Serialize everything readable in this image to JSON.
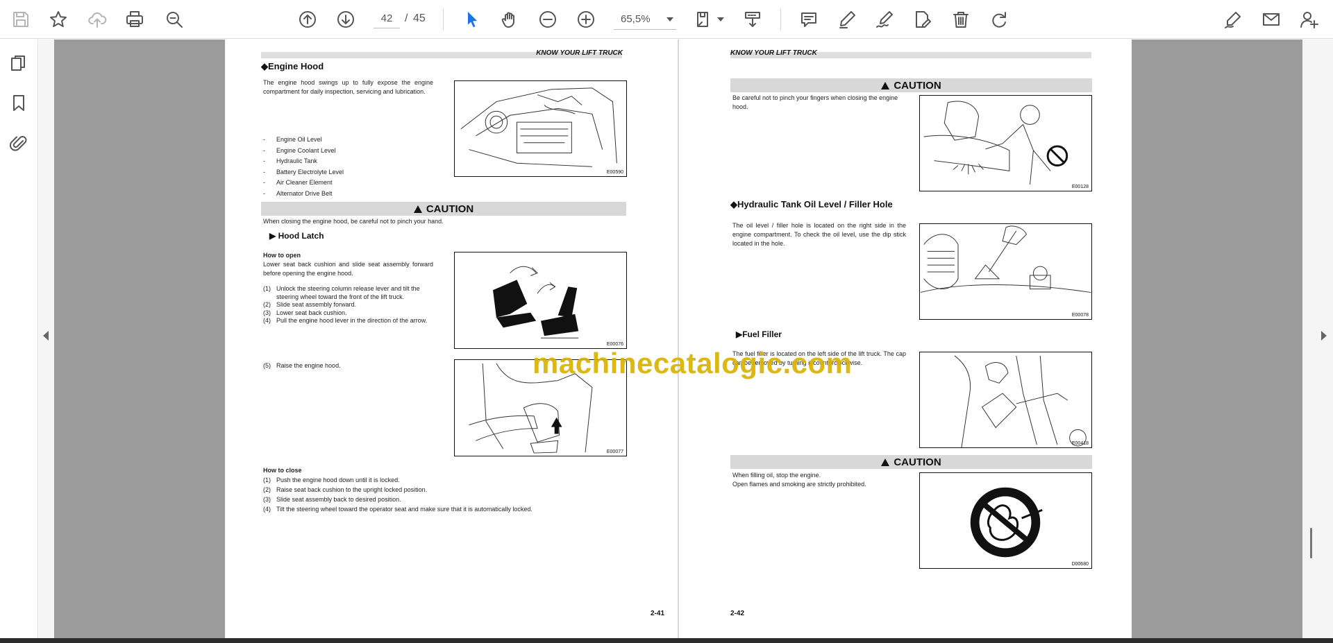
{
  "toolbar": {
    "page_current": "42",
    "page_separator": "/",
    "page_total": "45",
    "zoom": "65,5%"
  },
  "left_page": {
    "header": "KNOW YOUR LIFT TRUCK",
    "engine_hood_title": "◆Engine Hood",
    "engine_hood_intro": "The engine hood swings up to fully expose the engine compartment for daily inspection, servicing and lubrication.",
    "checklist": [
      "Engine Oil Level",
      "Engine Coolant Level",
      "Hydraulic Tank",
      "Battery Electrolyte Level",
      "Air Cleaner Element",
      "Alternator Drive Belt"
    ],
    "checklist_bullet": "-",
    "fig1_code": "E00590",
    "caution_label": "CAUTION",
    "caution_text": "When closing the engine hood, be careful not to pinch your hand.",
    "hood_latch_title": "▶ Hood Latch",
    "how_to_open_title": "How to open",
    "how_to_open_intro": "Lower seat back cushion and slide seat assembly forward before opening the engine hood.",
    "open_steps": [
      {
        "n": "(1)",
        "t": "Unlock the steering column release lever and tilt the"
      },
      {
        "n": "",
        "t": "steering wheel toward the front of the lift truck."
      },
      {
        "n": "(2)",
        "t": "Slide seat assembly forward."
      },
      {
        "n": "(3)",
        "t": "Lower seat back cushion."
      },
      {
        "n": "(4)",
        "t": "Pull the engine hood lever in the direction of the arrow."
      }
    ],
    "fig2_code": "E00076",
    "raise_step": {
      "n": "(5)",
      "t": "Raise the engine hood."
    },
    "fig3_code": "E00077",
    "how_to_close_title": "How to close",
    "close_steps": [
      {
        "n": "(1)",
        "t": "Push the engine hood down until it is locked."
      },
      {
        "n": "(2)",
        "t": "Raise seat back cushion to the upright locked position."
      },
      {
        "n": "(3)",
        "t": "Slide seat assembly back to desired position."
      },
      {
        "n": "(4)",
        "t": "Tilt the steering wheel toward the operator seat and make sure that it is automatically locked."
      }
    ],
    "page_number": "2-41"
  },
  "right_page": {
    "header": "KNOW YOUR LIFT TRUCK",
    "caution1_label": "CAUTION",
    "caution1_text": "Be careful not to pinch your fingers when closing the engine hood.",
    "fig1_code": "E00128",
    "hydraulic_title": "◆Hydraulic Tank Oil Level / Filler Hole",
    "hydraulic_text": "The oil level / filler hole is located on the right side in the engine compartment. To check the oil level, use the dip stick located in the hole.",
    "fig2_code": "E00078",
    "fuel_title": "▶Fuel Filler",
    "fuel_text": "The fuel filler is located on the left side of the lift truck. The cap can be removed by turning it counterclockwise.",
    "fig3_code": "E00418",
    "caution2_label": "CAUTION",
    "caution2_line1": "When filling oil, stop the engine.",
    "caution2_line2": "Open flames and smoking are strictly prohibited.",
    "fig4_code": "D00680",
    "page_number": "2-42"
  },
  "watermark": "machinecatalogic.com",
  "icons": {
    "save": "save-icon",
    "bookmark_star": "star-icon",
    "upload": "cloud-upload-icon",
    "print": "print-icon",
    "zoom_search": "zoom-search-icon",
    "prev_page": "arrow-up-circle-icon",
    "next_page": "arrow-down-circle-icon",
    "select": "cursor-icon",
    "hand": "hand-icon",
    "zoom_out": "minus-circle-icon",
    "zoom_in": "plus-circle-icon",
    "fit": "fit-page-icon",
    "scroll_mode": "scroll-mode-icon",
    "comment": "comment-icon",
    "highlight": "pen-icon",
    "draw": "draw-icon",
    "edit": "edit-icon",
    "delete": "trash-icon",
    "redo": "redo-icon",
    "sign": "sign-icon",
    "email": "mail-icon",
    "share": "add-user-icon",
    "pages_panel": "pages-icon",
    "bookmarks_panel": "bookmark-icon",
    "attachments_panel": "paperclip-icon"
  },
  "colors": {
    "accent": "#1a73e8",
    "watermark": "#d9b300",
    "caution_bar": "#d8d8d8"
  }
}
